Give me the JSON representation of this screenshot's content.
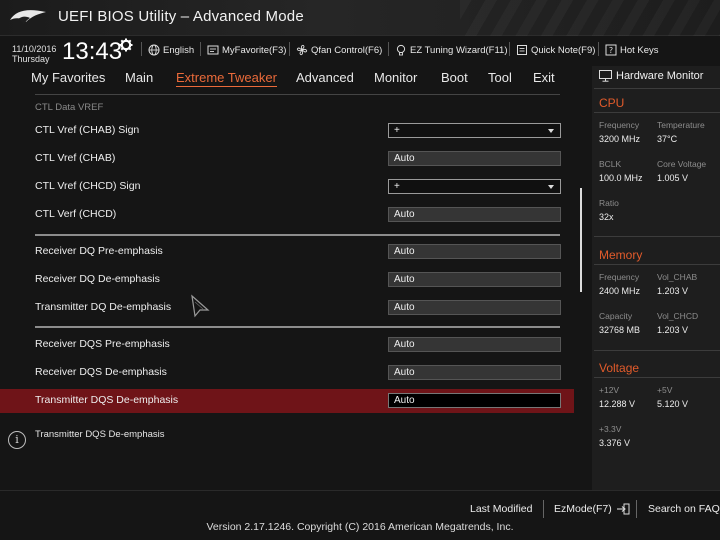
{
  "title_bar": {
    "app_title": "UEFI BIOS Utility – Advanced Mode",
    "logo_icon": "rog-eye-logo"
  },
  "info_bar": {
    "date": "11/10/2016",
    "day": "Thursday",
    "time": "13:43",
    "settings_icon": "gear-icon",
    "tools": [
      {
        "label": "English",
        "icon": "globe-icon"
      },
      {
        "label": "MyFavorite(F3)",
        "icon": "favorite-icon"
      },
      {
        "label": "Qfan Control(F6)",
        "icon": "fan-icon"
      },
      {
        "label": "EZ Tuning Wizard(F11)",
        "icon": "bulb-icon"
      },
      {
        "label": "Quick Note(F9)",
        "icon": "note-icon"
      },
      {
        "label": "Hot Keys",
        "icon": "help-icon"
      }
    ]
  },
  "menu": {
    "items": [
      "My Favorites",
      "Main",
      "Extreme Tweaker",
      "Advanced",
      "Monitor",
      "Boot",
      "Tool",
      "Exit"
    ],
    "active": "Extreme Tweaker"
  },
  "content": {
    "group_label": "CTL Data VREF",
    "rows": [
      {
        "label": "CTL Vref (CHAB) Sign",
        "value": "+",
        "kind": "dropdown"
      },
      {
        "label": "CTL Vref (CHAB)",
        "value": "Auto",
        "kind": "field"
      },
      {
        "label": "CTL Vref (CHCD) Sign",
        "value": "+",
        "kind": "dropdown"
      },
      {
        "label": "CTL Verf (CHCD)",
        "value": "Auto",
        "kind": "field"
      },
      {
        "label": "Receiver DQ Pre-emphasis",
        "value": "Auto",
        "kind": "field"
      },
      {
        "label": "Receiver DQ De-emphasis",
        "value": "Auto",
        "kind": "field"
      },
      {
        "label": "Transmitter DQ De-emphasis",
        "value": "Auto",
        "kind": "field"
      },
      {
        "label": "Receiver DQS Pre-emphasis",
        "value": "Auto",
        "kind": "field"
      },
      {
        "label": "Receiver DQS De-emphasis",
        "value": "Auto",
        "kind": "field"
      },
      {
        "label": "Transmitter DQS De-emphasis",
        "value": "Auto",
        "kind": "field",
        "selected": true
      }
    ]
  },
  "help": {
    "icon": "info-icon",
    "text": "Transmitter DQS De-emphasis"
  },
  "hardware_monitor": {
    "title": "Hardware Monitor",
    "icon": "monitor-icon",
    "cpu": {
      "heading": "CPU",
      "frequency_label": "Frequency",
      "frequency": "3200 MHz",
      "temperature_label": "Temperature",
      "temperature": "37°C",
      "bclk_label": "BCLK",
      "bclk": "100.0 MHz",
      "core_voltage_label": "Core Voltage",
      "core_voltage": "1.005 V",
      "ratio_label": "Ratio",
      "ratio": "32x"
    },
    "memory": {
      "heading": "Memory",
      "frequency_label": "Frequency",
      "frequency": "2400 MHz",
      "vol_chab_label": "Vol_CHAB",
      "vol_chab": "1.203 V",
      "capacity_label": "Capacity",
      "capacity": "32768 MB",
      "vol_chcd_label": "Vol_CHCD",
      "vol_chcd": "1.203 V"
    },
    "voltage": {
      "heading": "Voltage",
      "v12_label": "+12V",
      "v12": "12.288 V",
      "v5_label": "+5V",
      "v5": "5.120 V",
      "v33_label": "+3.3V",
      "v33": "3.376 V"
    }
  },
  "bottom": {
    "last_modified": "Last Modified",
    "ezmode": "EzMode(F7)",
    "ezmode_icon": "exit-arrow-icon",
    "search": "Search on FAQ",
    "version": "Version 2.17.1246. Copyright (C) 2016 American Megatrends, Inc."
  },
  "colors": {
    "accent": "#ea6a3a",
    "highlight_row": "#6f1418",
    "section_heading": "#e25b2b"
  }
}
